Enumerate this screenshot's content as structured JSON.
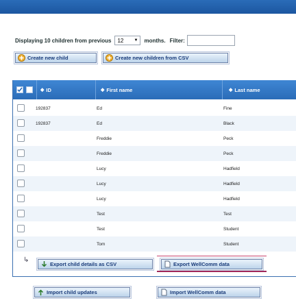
{
  "filter": {
    "prefix": "Displaying 10 children from previous",
    "months_value": "12",
    "suffix": "months.",
    "filter_label": "Filter:",
    "filter_value": ""
  },
  "actions": {
    "create_child": "Create new child",
    "create_children_csv": "Create new children from CSV"
  },
  "table": {
    "columns": {
      "id": "ID",
      "first_name": "First name",
      "last_name": "Last name"
    },
    "rows": [
      {
        "id": "192837",
        "first": "Ed",
        "last": "Fine"
      },
      {
        "id": "192837",
        "first": "Ed",
        "last": "Black"
      },
      {
        "id": "",
        "first": "Freddie",
        "last": "Peck"
      },
      {
        "id": "",
        "first": "Freddie",
        "last": "Peck"
      },
      {
        "id": "",
        "first": "Lucy",
        "last": "Hadfield"
      },
      {
        "id": "",
        "first": "Lucy",
        "last": "Hadfield"
      },
      {
        "id": "",
        "first": "Lucy",
        "last": "Hadfield"
      },
      {
        "id": "",
        "first": "Test",
        "last": "Test"
      },
      {
        "id": "",
        "first": "Test",
        "last": "Student"
      },
      {
        "id": "",
        "first": "Tom",
        "last": "Student"
      }
    ]
  },
  "export": {
    "child_details_csv": "Export child details as CSV",
    "wellcomm_data": "Export WellComm data"
  },
  "import": {
    "child_updates": "Import child updates",
    "wellcomm_data": "Import WellComm data"
  },
  "colors": {
    "header_blue": "#2a6cb8",
    "button_text": "#1a3c7a",
    "highlight_underline": "#a0285a"
  }
}
